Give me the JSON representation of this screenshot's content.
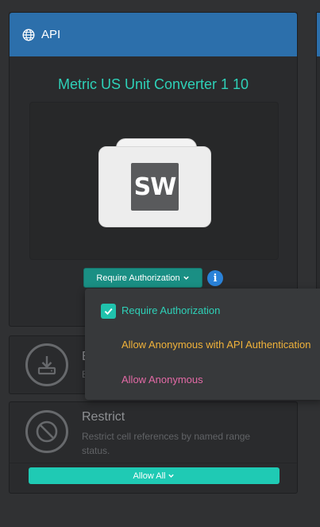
{
  "api_card": {
    "header_label": "API",
    "title": "Metric US Unit Converter 1 10",
    "logo_text": "SW",
    "auth_button_label": "Require Authorization",
    "info_label": "i"
  },
  "export_card": {
    "title": "E",
    "desc": "E"
  },
  "restrict_card": {
    "title": "Restrict",
    "desc": "Restrict cell references by named range status.",
    "button_label": "Allow All"
  },
  "auth_dropdown": {
    "options": [
      {
        "label": "Require Authorization",
        "selected": true,
        "color": "#2ed1b8"
      },
      {
        "label": "Allow Anonymous with API Authentication",
        "selected": false,
        "color": "#f0b23a"
      },
      {
        "label": "Allow Anonymous",
        "selected": false,
        "color": "#e36aa6"
      }
    ]
  },
  "colors": {
    "header_blue": "#2c6fab",
    "accent_teal": "#2ed1b8",
    "button_teal": "#1fcab4",
    "info_blue": "#2a82d8"
  }
}
